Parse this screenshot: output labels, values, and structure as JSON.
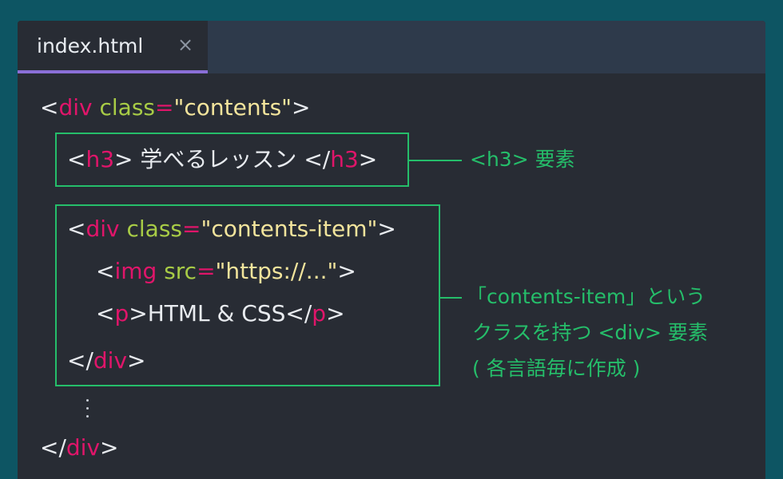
{
  "tab": {
    "title": "index.html",
    "close": "×"
  },
  "code": {
    "line1": {
      "open": "<",
      "tag": "div",
      "attr": " class",
      "eq": "=",
      "str": "\"contents\"",
      "close": ">"
    },
    "line2": {
      "open": "<",
      "tag": "h3",
      "close": ">",
      "text": " 学べるレッスン ",
      "end_open": "</",
      "end_tag": "h3",
      "end_close": ">"
    },
    "line3": {
      "open": "<",
      "tag": "div",
      "attr": " class",
      "eq": "=",
      "str": "\"contents-item\"",
      "close": ">"
    },
    "line4": {
      "open": "<",
      "tag": "img",
      "attr": " src",
      "eq": "=",
      "str": "\"https://...\"",
      "close": ">"
    },
    "line5": {
      "open": "<",
      "tag": "p",
      "close": ">",
      "text": "HTML & CSS",
      "end_open": "</",
      "end_tag": "p",
      "end_close": ">"
    },
    "line6": {
      "open": "</",
      "tag": "div",
      "close": ">"
    },
    "line8": {
      "open": "</",
      "tag": "div",
      "close": ">"
    }
  },
  "annotations": {
    "h3_note": "<h3> 要素",
    "item_note_line1": "「contents-item」という",
    "item_note_line2": "クラスを持つ <div> 要素",
    "item_note_line3": "( 各言語毎に作成 )"
  },
  "colors": {
    "background": "#0d5563",
    "editor": "#282c34",
    "tag": "#e0156a",
    "attribute": "#a8cc46",
    "string": "#f2e49c",
    "annotation": "#25be6a",
    "tab_indicator": "#8a6fd8"
  }
}
